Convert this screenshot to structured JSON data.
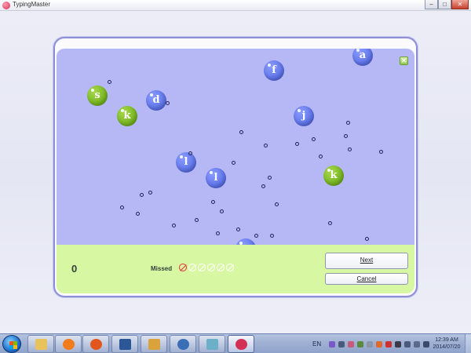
{
  "window": {
    "title": "TypingMaster",
    "minimize_glyph": "–",
    "maximize_glyph": "□",
    "close_glyph": "✕"
  },
  "game": {
    "close_glyph": "✕",
    "bubbles": [
      {
        "letter": "a",
        "color": "blue"
      },
      {
        "letter": "f",
        "color": "blue"
      },
      {
        "letter": "s",
        "color": "green"
      },
      {
        "letter": "d",
        "color": "blue"
      },
      {
        "letter": "k",
        "color": "green"
      },
      {
        "letter": "j",
        "color": "blue"
      },
      {
        "letter": "l",
        "color": "blue"
      },
      {
        "letter": "l",
        "color": "blue"
      },
      {
        "letter": "k",
        "color": "green"
      }
    ],
    "score": "0",
    "missed_label": "Missed",
    "missed": 1,
    "missed_total": 6
  },
  "buttons": {
    "next_label": "Next",
    "cancel_label": "Cancel"
  },
  "taskbar": {
    "items": [
      {
        "name": "explorer",
        "icon": "folder-icon",
        "color": "#e8c25a"
      },
      {
        "name": "media-player",
        "icon": "play-icon",
        "color": "#f07c1c"
      },
      {
        "name": "firefox",
        "icon": "firefox-icon",
        "color": "#e2561d"
      },
      {
        "name": "word",
        "icon": "word-icon",
        "color": "#2b5797"
      },
      {
        "name": "search",
        "icon": "magnifier-icon",
        "color": "#d9a23a"
      },
      {
        "name": "media-center",
        "icon": "media-center-icon",
        "color": "#3a6fb8"
      },
      {
        "name": "window",
        "icon": "window-icon",
        "color": "#6bb0c8"
      },
      {
        "name": "typingmaster",
        "icon": "typingmaster-icon",
        "color": "#d42f55"
      }
    ],
    "language": "EN",
    "time": "12:39 AM",
    "date": "2014/07/20"
  }
}
